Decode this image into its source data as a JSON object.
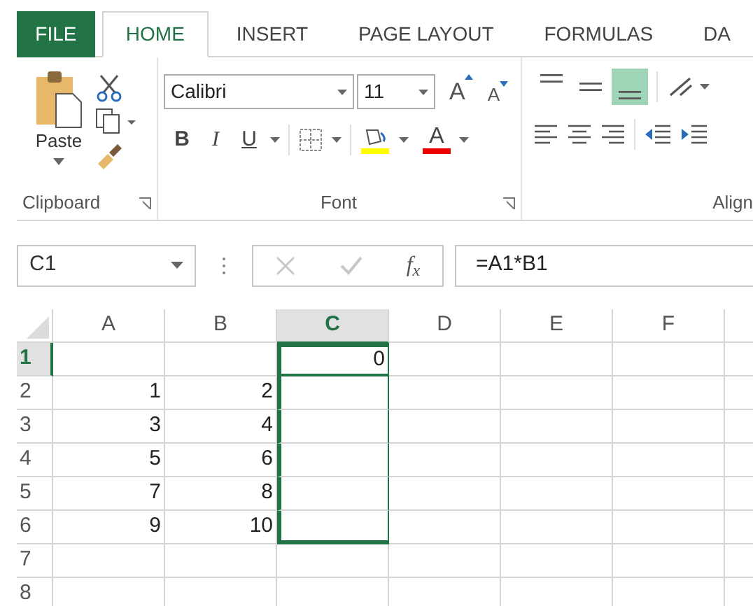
{
  "tabs": [
    {
      "label": "FILE",
      "kind": "file",
      "selected": false
    },
    {
      "label": "HOME",
      "kind": "tab",
      "selected": true
    },
    {
      "label": "INSERT",
      "kind": "tab",
      "selected": false
    },
    {
      "label": "PAGE LAYOUT",
      "kind": "tab",
      "selected": false
    },
    {
      "label": "FORMULAS",
      "kind": "tab",
      "selected": false
    },
    {
      "label": "DA",
      "kind": "tab",
      "selected": false
    }
  ],
  "ribbon": {
    "clipboard": {
      "paste_label": "Paste",
      "group_label": "Clipboard"
    },
    "font": {
      "font_name": "Calibri",
      "font_size": "11",
      "grow_label": "A",
      "shrink_label": "A",
      "bold_label": "B",
      "italic_label": "I",
      "underline_label": "U",
      "font_color_label": "A",
      "group_label": "Font"
    },
    "alignment": {
      "vertical_align": [
        {
          "selected": false
        },
        {
          "selected": false
        },
        {
          "selected": true
        }
      ],
      "group_label": "Align"
    }
  },
  "formula_bar": {
    "name_box": "C1",
    "function_label": "f$_{x}$",
    "formula": "=A1*B1"
  },
  "sheet": {
    "columns": [
      {
        "label": "A",
        "selected": false
      },
      {
        "label": "B",
        "selected": false
      },
      {
        "label": "C",
        "selected": true
      },
      {
        "label": "D",
        "selected": false
      },
      {
        "label": "E",
        "selected": false
      },
      {
        "label": "F",
        "selected": false
      }
    ],
    "rows": [
      {
        "number": "1",
        "selected": true,
        "in_selection": true,
        "cells": {
          "C": "0"
        }
      },
      {
        "number": "2",
        "selected": false,
        "in_selection": true,
        "cells": {
          "A": "1",
          "B": "2"
        }
      },
      {
        "number": "3",
        "selected": false,
        "in_selection": true,
        "cells": {
          "A": "3",
          "B": "4"
        }
      },
      {
        "number": "4",
        "selected": false,
        "in_selection": true,
        "cells": {
          "A": "5",
          "B": "6"
        }
      },
      {
        "number": "5",
        "selected": false,
        "in_selection": true,
        "cells": {
          "A": "7",
          "B": "8"
        }
      },
      {
        "number": "6",
        "selected": false,
        "in_selection": true,
        "cells": {
          "A": "9",
          "B": "10"
        }
      },
      {
        "number": "7",
        "selected": false,
        "in_selection": false
      },
      {
        "number": "8",
        "selected": false,
        "in_selection": false
      }
    ]
  }
}
